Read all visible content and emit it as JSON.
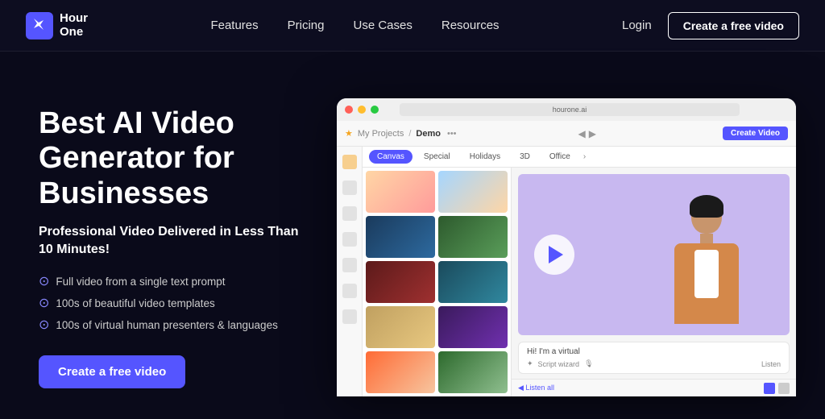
{
  "nav": {
    "logo_line1": "Hour",
    "logo_line2": "One",
    "links": [
      {
        "label": "Features",
        "id": "features"
      },
      {
        "label": "Pricing",
        "id": "pricing"
      },
      {
        "label": "Use Cases",
        "id": "use-cases"
      },
      {
        "label": "Resources",
        "id": "resources"
      }
    ],
    "login_label": "Login",
    "create_btn_label": "Create a free video"
  },
  "hero": {
    "title": "Best AI Video Generator for Businesses",
    "subtitle": "Professional Video Delivered in Less Than 10 Minutes!",
    "features": [
      "Full video from a single text prompt",
      "100s of beautiful video templates",
      "100s of virtual human presenters & languages"
    ],
    "cta_label": "Create a free video"
  },
  "app_mockup": {
    "breadcrumb_my_projects": "My Projects",
    "breadcrumb_sep": "/",
    "breadcrumb_demo": "Demo",
    "create_video_btn": "Create Video",
    "tabs": [
      "Canvas",
      "Special",
      "Holidays",
      "3D",
      "Office"
    ],
    "active_tab": "Canvas",
    "hi_text": "Hi! I'm a virtual",
    "script_label": "Script wizard",
    "listen_label": "Listen",
    "listen_all_label": "◀ Listen all",
    "url_text": "hourone.ai"
  }
}
